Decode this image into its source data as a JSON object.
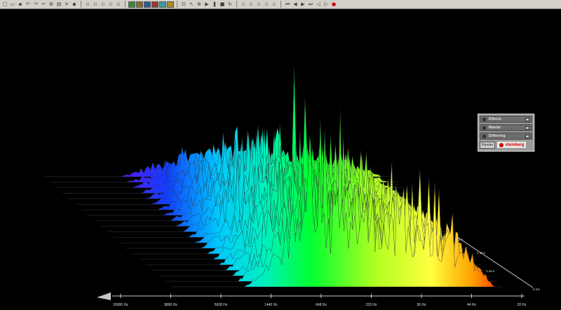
{
  "toolbar": {
    "groups": [
      [
        "new-icon",
        "open-icon",
        "save-icon",
        "undo-icon",
        "redo-icon",
        "cut-icon",
        "copy-icon",
        "paste-icon",
        "delete-icon",
        "marker-icon"
      ],
      [
        "view-waveform-icon",
        "view-split-icon",
        "view-list-icon",
        "view-grid-icon",
        "view-detail-icon"
      ],
      [
        "color-view-1-icon",
        "color-view-2-icon",
        "color-view-3-icon",
        "color-view-4-icon",
        "color-view-5-icon",
        "color-view-6-icon"
      ],
      [
        "snapshot-icon",
        "pointer-icon",
        "zoom-icon",
        "play-icon",
        "pause-icon",
        "stop-icon",
        "loop-icon"
      ],
      [
        "tool-1-icon",
        "tool-2-icon",
        "tool-3-icon",
        "tool-4-icon",
        "tool-5-icon"
      ],
      [
        "rewind-start-icon",
        "rewind-icon",
        "fast-forward-icon",
        "forward-end-icon",
        "step-back-icon",
        "step-forward-icon",
        "record-icon"
      ]
    ]
  },
  "panel": {
    "rows": [
      {
        "label": "Effects"
      },
      {
        "label": "Master"
      },
      {
        "label": "Dithering"
      }
    ],
    "render_label": "Render",
    "brand": "steinberg"
  },
  "axes": {
    "freq_labels": [
      "20000 Hz",
      "9800 Hz",
      "5628 Hz",
      "1440 Hz",
      "648 Hz",
      "233 Hz",
      "95 Hz",
      "44 Hz",
      "20 Hz"
    ],
    "time_labels": [
      "2.1 s",
      "1.16 s",
      "1.16 s",
      "0 ms"
    ]
  },
  "colors": {
    "background": "#000000",
    "record": "#cc0000",
    "brand": "#cc0000"
  }
}
